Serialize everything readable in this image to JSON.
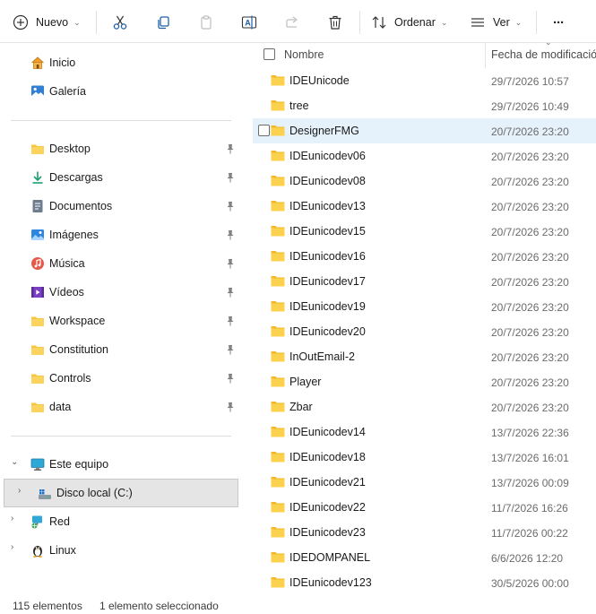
{
  "toolbar": {
    "new_label": "Nuevo",
    "sort_label": "Ordenar",
    "view_label": "Ver",
    "more_label": "···"
  },
  "sidebar": {
    "quick": [
      {
        "label": "Inicio"
      },
      {
        "label": "Galería"
      }
    ],
    "pinned": [
      {
        "label": "Desktop"
      },
      {
        "label": "Descargas"
      },
      {
        "label": "Documentos"
      },
      {
        "label": "Imágenes"
      },
      {
        "label": "Música"
      },
      {
        "label": "Vídeos"
      },
      {
        "label": "Workspace"
      },
      {
        "label": "Constitution"
      },
      {
        "label": "Controls"
      },
      {
        "label": "data"
      }
    ],
    "tree": [
      {
        "label": "Este equipo"
      },
      {
        "label": "Disco local (C:)"
      },
      {
        "label": "Red"
      },
      {
        "label": "Linux"
      }
    ]
  },
  "columns": {
    "name": "Nombre",
    "date": "Fecha de modificación"
  },
  "files": [
    {
      "name": "IDEUnicode",
      "date": "29/7/2026 10:57"
    },
    {
      "name": "tree",
      "date": "29/7/2026 10:49"
    },
    {
      "name": "DesignerFMG",
      "date": "20/7/2026 23:20"
    },
    {
      "name": "IDEunicodev06",
      "date": "20/7/2026 23:20"
    },
    {
      "name": "IDEunicodev08",
      "date": "20/7/2026 23:20"
    },
    {
      "name": "IDEunicodev13",
      "date": "20/7/2026 23:20"
    },
    {
      "name": "IDEunicodev15",
      "date": "20/7/2026 23:20"
    },
    {
      "name": "IDEunicodev16",
      "date": "20/7/2026 23:20"
    },
    {
      "name": "IDEunicodev17",
      "date": "20/7/2026 23:20"
    },
    {
      "name": "IDEunicodev19",
      "date": "20/7/2026 23:20"
    },
    {
      "name": "IDEunicodev20",
      "date": "20/7/2026 23:20"
    },
    {
      "name": "InOutEmail-2",
      "date": "20/7/2026 23:20"
    },
    {
      "name": "Player",
      "date": "20/7/2026 23:20"
    },
    {
      "name": "Zbar",
      "date": "20/7/2026 23:20"
    },
    {
      "name": "IDEunicodev14",
      "date": "13/7/2026 22:36"
    },
    {
      "name": "IDEunicodev18",
      "date": "13/7/2026 16:01"
    },
    {
      "name": "IDEunicodev21",
      "date": "13/7/2026 00:09"
    },
    {
      "name": "IDEunicodev22",
      "date": "11/7/2026 16:26"
    },
    {
      "name": "IDEunicodev23",
      "date": "11/7/2026 00:22"
    },
    {
      "name": "IDEDOMPANEL",
      "date": "6/6/2026 12:20"
    },
    {
      "name": "IDEunicodev123",
      "date": "30/5/2026 00:00"
    }
  ],
  "status": {
    "count": "115 elementos",
    "selection": "1 elemento seleccionado"
  },
  "colors": {
    "accent": "#0078d4",
    "folder": "#f8c63d",
    "hover_row": "#e5f1fb"
  }
}
